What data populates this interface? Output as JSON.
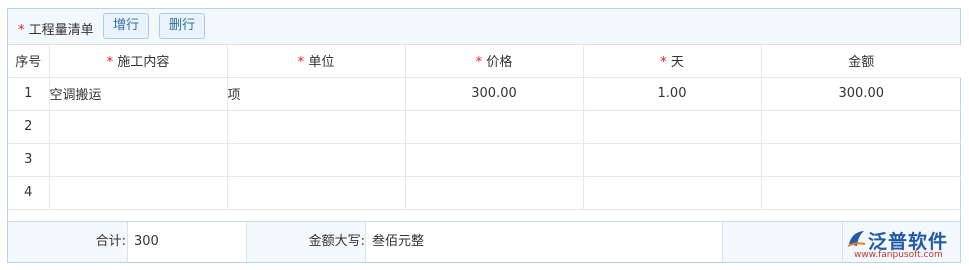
{
  "toolbar": {
    "required_mark": "*",
    "title": "工程量清单",
    "add_row_label": "增行",
    "delete_row_label": "删行"
  },
  "table": {
    "headers": [
      {
        "label": "序号",
        "required": false
      },
      {
        "label": "施工内容",
        "required": true
      },
      {
        "label": "单位",
        "required": true
      },
      {
        "label": "价格",
        "required": true
      },
      {
        "label": "天",
        "required": true
      },
      {
        "label": "金额",
        "required": false
      }
    ],
    "required_mark": "*",
    "rows": [
      {
        "no": "1",
        "content": "空调搬运",
        "unit": "项",
        "price": "300.00",
        "days": "1.00",
        "amount": "300.00"
      },
      {
        "no": "2",
        "content": "",
        "unit": "",
        "price": "",
        "days": "",
        "amount": ""
      },
      {
        "no": "3",
        "content": "",
        "unit": "",
        "price": "",
        "days": "",
        "amount": ""
      },
      {
        "no": "4",
        "content": "",
        "unit": "",
        "price": "",
        "days": "",
        "amount": ""
      }
    ]
  },
  "footer": {
    "total_label": "合计:",
    "total_value": "300",
    "amount_words_label": "金额大写:",
    "amount_words_value": "叁佰元整"
  },
  "watermark": {
    "brand": "泛普软件",
    "url": "www.fanpusoft.com"
  }
}
